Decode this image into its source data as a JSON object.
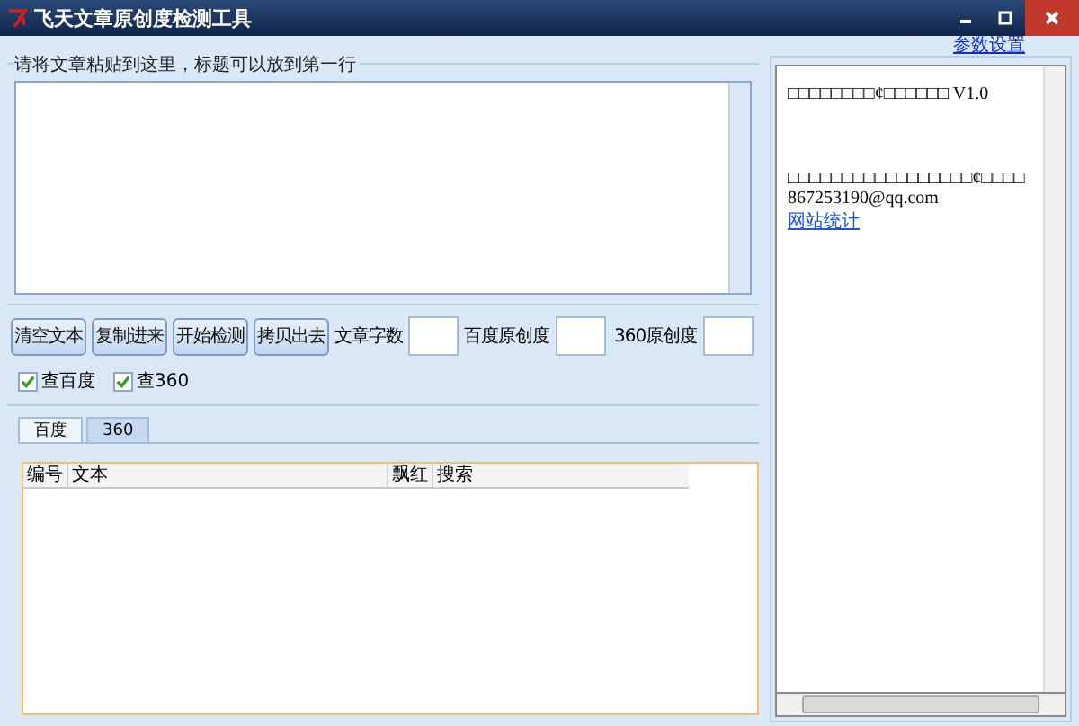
{
  "window": {
    "title": "飞天文章原创度检测工具"
  },
  "settings_link": "参数设置",
  "input_group": {
    "label": "请将文章粘贴到这里，标题可以放到第一行"
  },
  "buttons": [
    "清空文本",
    "复制进来",
    "开始检测",
    "拷贝出去"
  ],
  "stats": [
    {
      "label": "文章字数"
    },
    {
      "label": "百度原创度"
    },
    {
      "label": "360原创度"
    }
  ],
  "checkboxes": [
    {
      "label": "查百度",
      "checked": true
    },
    {
      "label": "查360",
      "checked": true
    }
  ],
  "tabs": [
    {
      "label": "百度",
      "selected": true
    },
    {
      "label": "360",
      "selected": false
    }
  ],
  "table": {
    "columns": [
      "编号",
      "文本",
      "飘红",
      "搜索"
    ]
  },
  "info_panel": {
    "lines": [
      {
        "kind": "text",
        "text": "□□□□□□□□¢□□□□□□ V1.0"
      },
      {
        "kind": "text",
        "text": "□□□□□□□□□□□□□□□□□¢□□□□"
      },
      {
        "kind": "text",
        "text": "867253190@qq.com"
      },
      {
        "kind": "link",
        "text": "网站统计"
      }
    ]
  }
}
